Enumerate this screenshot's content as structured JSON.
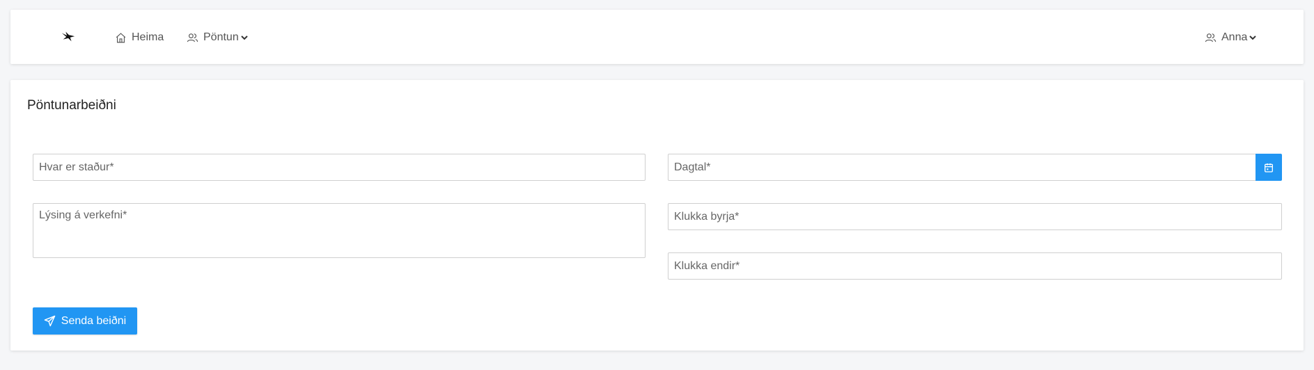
{
  "nav": {
    "home_label": "Heima",
    "order_label": "Pöntun",
    "user_label": "Anna"
  },
  "page": {
    "title": "Pöntunarbeiðni"
  },
  "form": {
    "place_placeholder": "Hvar er staður*",
    "description_placeholder": "Lýsing á verkefni*",
    "date_placeholder": "Dagtal*",
    "start_time_placeholder": "Klukka byrja*",
    "end_time_placeholder": "Klukka endir*",
    "submit_label": "Senda beiðni"
  },
  "colors": {
    "accent": "#2196f3",
    "background": "#f5f6f8",
    "card": "#ffffff"
  },
  "icons": {
    "logo": "bird-logo-icon",
    "home": "home-icon",
    "order": "users-icon",
    "user": "user-icon",
    "date": "calendar-icon",
    "submit": "send-icon"
  }
}
